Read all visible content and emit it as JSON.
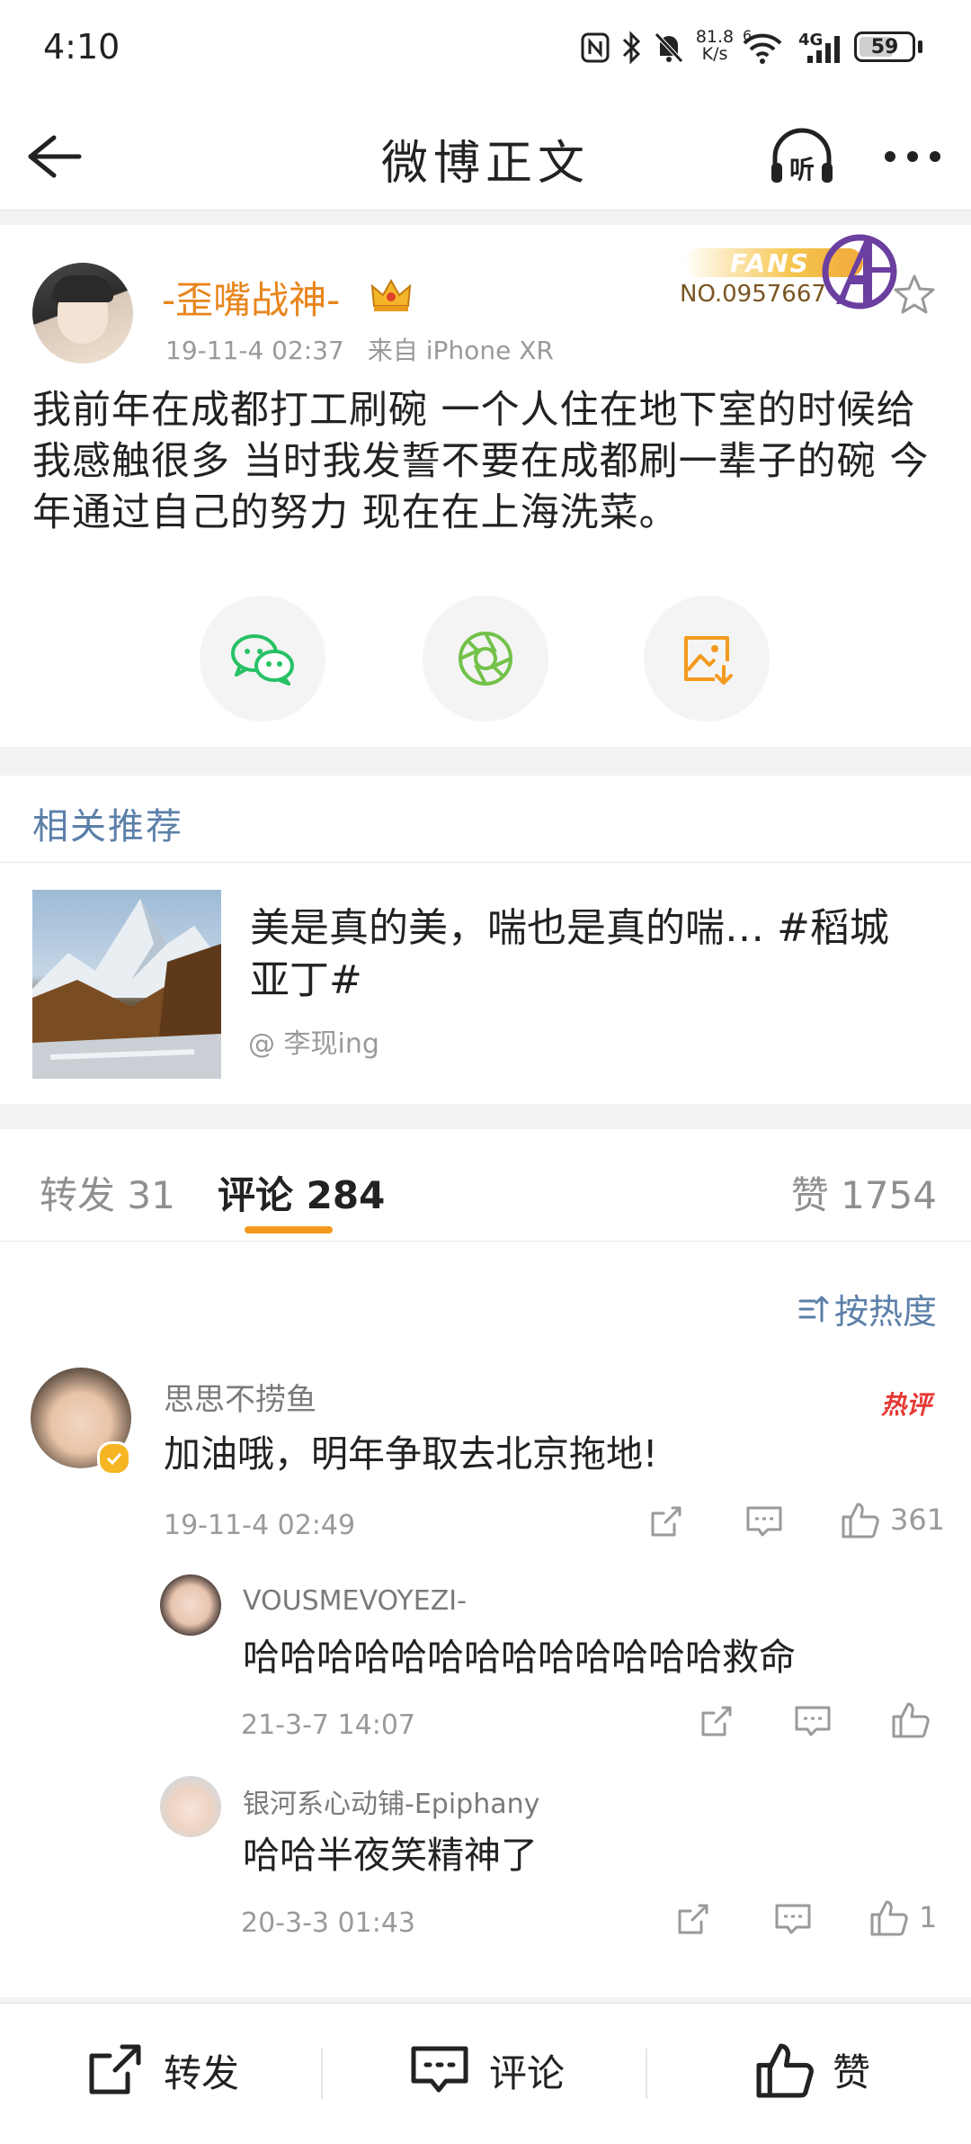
{
  "status_bar": {
    "time": "4:10",
    "net_speed_value": "81.8",
    "net_speed_unit": "K/s",
    "wifi_label": "6",
    "cell_label": "4G",
    "battery": "59"
  },
  "header": {
    "title": "微博正文",
    "listen_label": "听"
  },
  "post": {
    "author": "-歪嘴战神-",
    "fans_badge_text": "FANS",
    "fans_number": "NO.0957667",
    "time": "19-11-4 02:37",
    "source": "来自 iPhone XR",
    "text": "我前年在成都打工刷碗 一个人住在地下室的时候给我感触很多 当时我发誓不要在成都刷一辈子的碗 今年通过自己的努力 现在在上海洗菜。"
  },
  "related": {
    "section_title": "相关推荐",
    "item_title": "美是真的美，喘也是真的喘… #稻城亚丁#",
    "item_author": "@ 李现ing"
  },
  "tabs": {
    "repost": "转发 31",
    "comment": "评论 284",
    "like": "赞 1754"
  },
  "sort_label": "按热度",
  "comments": [
    {
      "name": "思思不捞鱼",
      "text": "加油哦，明年争取去北京拖地!",
      "time": "19-11-4 02:49",
      "likes": "361",
      "hot_tag": "热评",
      "replies": [
        {
          "name": "VOUSMEVOYEZI-",
          "text": "哈哈哈哈哈哈哈哈哈哈哈哈哈救命",
          "time": "21-3-7 14:07",
          "likes": ""
        },
        {
          "name": "银河系心动铺-Epiphany",
          "text": "哈哈半夜笑精神了",
          "time": "20-3-3 01:43",
          "likes": "1"
        }
      ]
    }
  ],
  "bottom_bar": {
    "repost": "转发",
    "comment": "评论",
    "like": "赞"
  },
  "colors": {
    "accent_orange": "#f39a1e",
    "author_orange": "#e8851c",
    "link_blue": "#5b7fa8",
    "wechat_green": "#27c165",
    "moments_green": "#73c24a"
  }
}
